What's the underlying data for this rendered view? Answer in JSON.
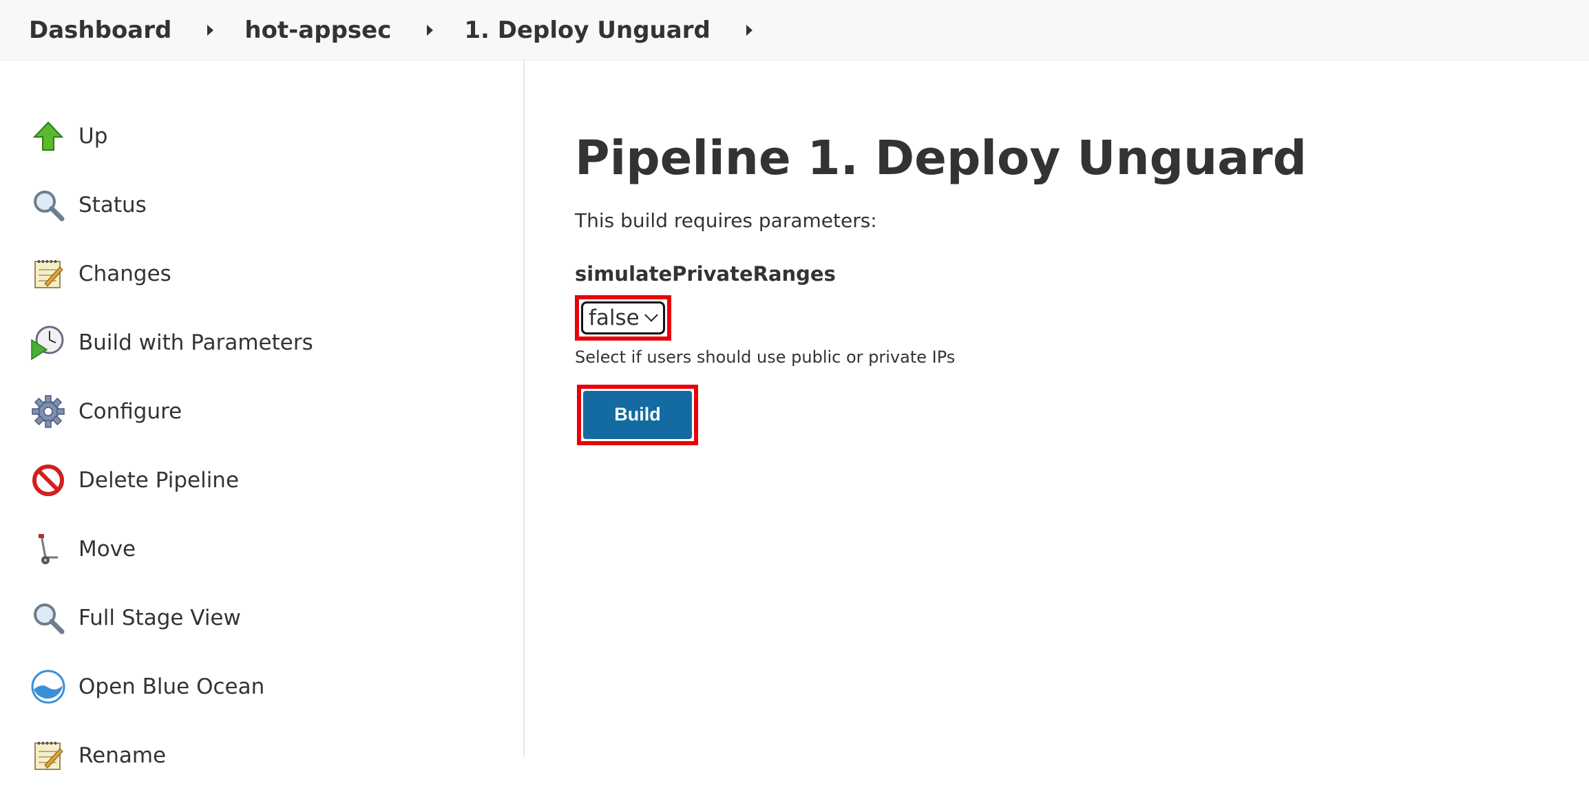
{
  "breadcrumb": {
    "items": [
      {
        "label": "Dashboard"
      },
      {
        "label": "hot-appsec"
      },
      {
        "label": "1. Deploy Unguard"
      }
    ]
  },
  "sidebar": {
    "items": [
      {
        "label": "Up",
        "icon": "up-arrow-icon"
      },
      {
        "label": "Status",
        "icon": "magnifier-icon"
      },
      {
        "label": "Changes",
        "icon": "notepad-icon"
      },
      {
        "label": "Build with Parameters",
        "icon": "clock-play-icon"
      },
      {
        "label": "Configure",
        "icon": "gear-icon"
      },
      {
        "label": "Delete Pipeline",
        "icon": "no-entry-icon"
      },
      {
        "label": "Move",
        "icon": "hand-truck-icon"
      },
      {
        "label": "Full Stage View",
        "icon": "magnifier-icon"
      },
      {
        "label": "Open Blue Ocean",
        "icon": "blue-ocean-icon"
      },
      {
        "label": "Rename",
        "icon": "notepad-icon"
      }
    ]
  },
  "main": {
    "title": "Pipeline 1. Deploy Unguard",
    "intro": "This build requires parameters:",
    "parameter": {
      "name": "simulatePrivateRanges",
      "selected_value": "false",
      "description": "Select if users should use public or private IPs"
    },
    "build_label": "Build"
  },
  "colors": {
    "accent": "#146ba1",
    "highlight": "#e8000a"
  }
}
